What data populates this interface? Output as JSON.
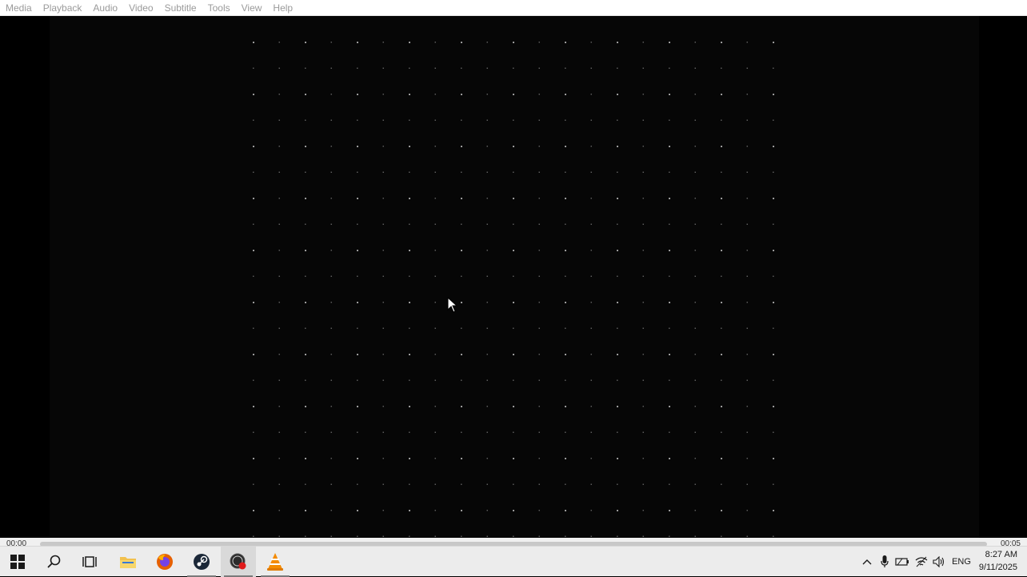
{
  "menu": {
    "items": [
      "Media",
      "Playback",
      "Audio",
      "Video",
      "Subtitle",
      "Tools",
      "View",
      "Help"
    ]
  },
  "player": {
    "time_elapsed": "00:00",
    "time_total": "00:05",
    "progress": 0.0
  },
  "taskbar": {
    "apps": [
      {
        "name": "start-icon"
      },
      {
        "name": "search-icon"
      },
      {
        "name": "task-view-icon"
      },
      {
        "name": "file-explorer-icon"
      },
      {
        "name": "firefox-icon"
      },
      {
        "name": "steam-icon"
      },
      {
        "name": "recorder-icon"
      },
      {
        "name": "vlc-icon"
      }
    ],
    "language": "ENG",
    "time": "8:27 AM",
    "date": "9/11/2025"
  }
}
